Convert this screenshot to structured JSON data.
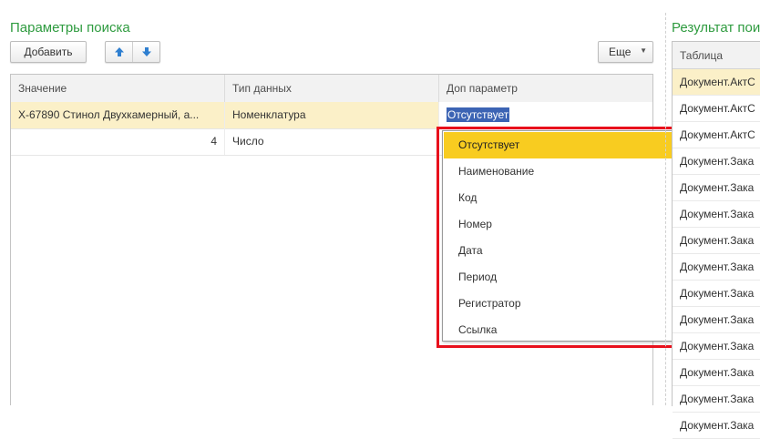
{
  "left_panel": {
    "title": "Параметры поиска",
    "add_button": "Добавить",
    "more_button": "Еще",
    "columns": [
      "Значение",
      "Тип данных",
      "Доп параметр"
    ],
    "rows": [
      {
        "value": "Х-67890 Стинол Двухкамерный, а...",
        "type": "Номенклатура",
        "extra": "Отсутствует"
      },
      {
        "value": "4",
        "type": "Число",
        "extra": ""
      }
    ]
  },
  "dropdown": {
    "items": [
      "Отсутствует",
      "Наименование",
      "Код",
      "Номер",
      "Дата",
      "Период",
      "Регистратор",
      "Ссылка"
    ],
    "selected_index": 0
  },
  "right_panel": {
    "title": "Результат пои",
    "column": "Таблица",
    "rows": [
      "Документ.АктС",
      "Документ.АктС",
      "Документ.АктС",
      "Документ.Зака",
      "Документ.Зака",
      "Документ.Зака",
      "Документ.Зака",
      "Документ.Зака",
      "Документ.Зака",
      "Документ.Зака",
      "Документ.Зака",
      "Документ.Зака",
      "Документ.Зака",
      "Документ.Зака"
    ]
  },
  "colors": {
    "title_green": "#2e9b3f",
    "selection_row": "#fbf0c8",
    "dropdown_active": "#f8cc20",
    "highlight_outline": "#e8101c",
    "arrow_blue": "#2f7fd0"
  }
}
